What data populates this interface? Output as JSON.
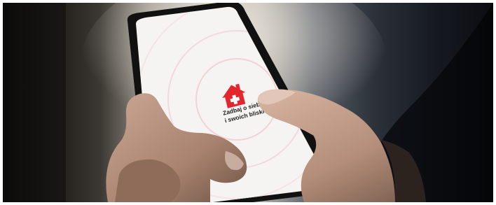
{
  "screen": {
    "caption_line_1": "Zadbaj o siebie",
    "caption_line_2": "i swoich bliskich"
  },
  "icons": {
    "app_icon": "house-with-cross-icon"
  },
  "colors": {
    "icon_red": "#e3262d",
    "screen_white": "#f6f4f3",
    "ring_pink": "#f3d9db",
    "phone_black": "#111111"
  }
}
